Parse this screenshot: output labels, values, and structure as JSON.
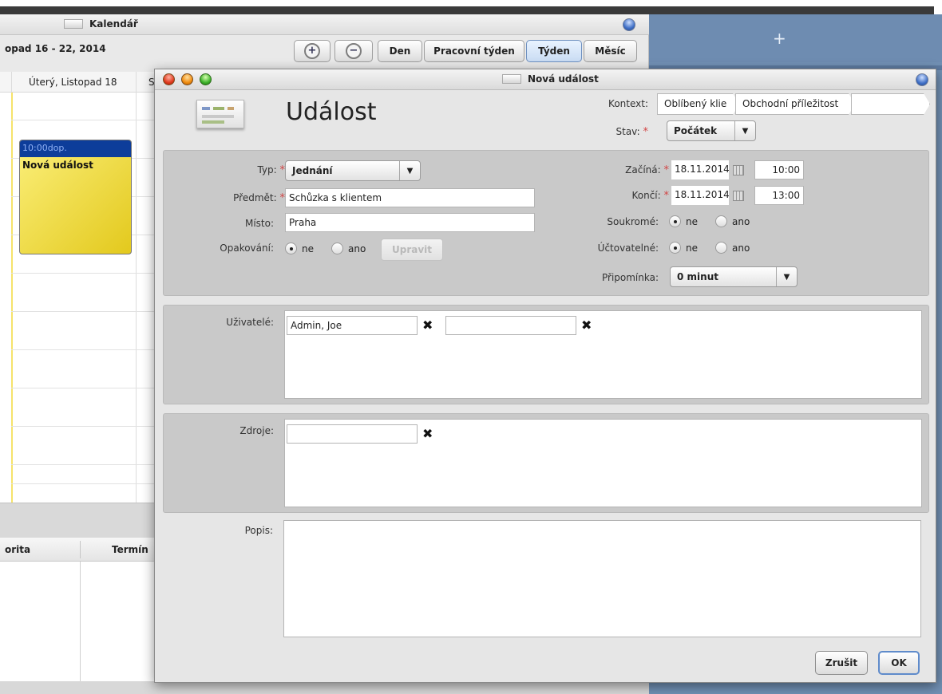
{
  "calendar": {
    "title": "Kalendář",
    "range": "opad 16 - 22, 2014",
    "zoom_in_icon": "zoom-in-icon",
    "zoom_out_icon": "zoom-out-icon",
    "views": [
      "Den",
      "Pracovní týden",
      "Týden",
      "Měsíc"
    ],
    "selected_view": "Týden",
    "day_header": "Úterý, Listopad 18",
    "next_day_header_partial": "S",
    "event": {
      "time": "10:00dop.",
      "title": "Nová událost"
    },
    "task_columns": [
      "orita",
      "Termín"
    ]
  },
  "right_pane": {
    "add_label": "+"
  },
  "dialog": {
    "title": "Nová událost",
    "heading": "Událost",
    "context_label": "Kontext:",
    "context_crumbs": [
      "Oblíbený klie",
      "Obchodní příležitost",
      ""
    ],
    "status_label": "Stav:",
    "status_value": "Počátek",
    "type_label": "Typ:",
    "type_value": "Jednání",
    "subject_label": "Předmět:",
    "subject_value": "Schůzka s klientem",
    "place_label": "Místo:",
    "place_value": "Praha",
    "repeat_label": "Opakování:",
    "repeat_options": [
      "ne",
      "ano"
    ],
    "repeat_selected": "ne",
    "repeat_edit_button": "Upravit",
    "start_label": "Začíná:",
    "start_date": "18.11.2014",
    "start_time": "10:00",
    "end_label": "Končí:",
    "end_date": "18.11.2014",
    "end_time": "13:00",
    "private_label": "Soukromé:",
    "private_options": [
      "ne",
      "ano"
    ],
    "private_selected": "ne",
    "billable_label": "Účtovatelné:",
    "billable_options": [
      "ne",
      "ano"
    ],
    "billable_selected": "ne",
    "reminder_label": "Připomínka:",
    "reminder_value": "0 minut",
    "users_label": "Uživatelé:",
    "users": [
      "Admin, Joe",
      ""
    ],
    "resources_label": "Zdroje:",
    "resources": [
      ""
    ],
    "description_label": "Popis:",
    "description_value": "",
    "cancel_button": "Zrušit",
    "ok_button": "OK"
  },
  "colors": {
    "accent_blue": "#5f8bcb",
    "event_header": "#0d3d9a",
    "event_body": "#f3e04a",
    "required_star": "#d24545",
    "right_pane": "#7190b4"
  }
}
